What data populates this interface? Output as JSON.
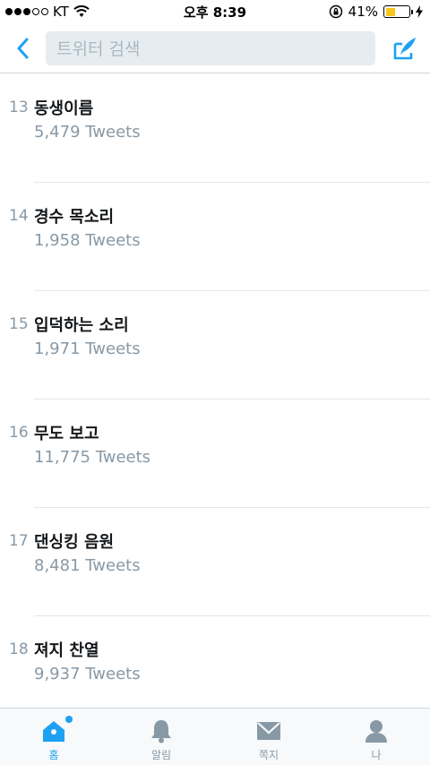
{
  "status_bar": {
    "carrier": "KT",
    "time": "오후 8:39",
    "battery": "41%",
    "battery_level": 0.41
  },
  "nav": {
    "search_placeholder": "트위터 검색"
  },
  "trends": [
    {
      "rank": "13",
      "topic": "동생이름",
      "count": "5,479 Tweets"
    },
    {
      "rank": "14",
      "topic": "경수 목소리",
      "count": "1,958 Tweets"
    },
    {
      "rank": "15",
      "topic": "입덕하는 소리",
      "count": "1,971 Tweets"
    },
    {
      "rank": "16",
      "topic": "무도 보고",
      "count": "11,775 Tweets"
    },
    {
      "rank": "17",
      "topic": "댄싱킹 음원",
      "count": "8,481 Tweets"
    },
    {
      "rank": "18",
      "topic": "져지 찬열",
      "count": "9,937 Tweets"
    }
  ],
  "tabs": [
    {
      "label": "홈",
      "icon": "home-icon"
    },
    {
      "label": "알림",
      "icon": "bell-icon"
    },
    {
      "label": "쪽지",
      "icon": "envelope-icon"
    },
    {
      "label": "나",
      "icon": "person-icon"
    }
  ],
  "colors": {
    "accent": "#1da1f2",
    "muted": "#8899a6",
    "battery": "#f5c518"
  }
}
